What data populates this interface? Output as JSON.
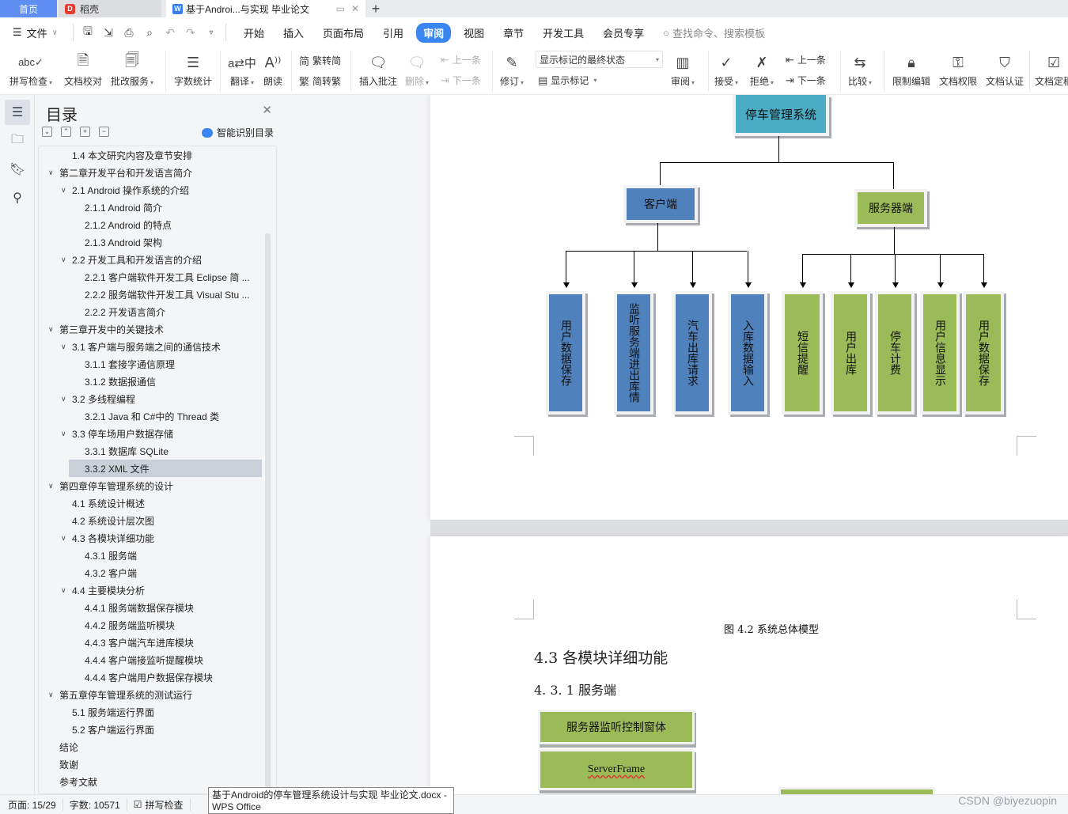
{
  "tabs": {
    "home": "首页",
    "daoke": "稻壳",
    "doc_title": "基于Androi...与实现 毕业论文",
    "new_tab": "+"
  },
  "menubar": {
    "file": "文件",
    "menus": [
      "开始",
      "插入",
      "页面布局",
      "引用",
      "审阅",
      "视图",
      "章节",
      "开发工具",
      "会员专享"
    ],
    "active_menu": "审阅",
    "search_placeholder": "查找命令、搜索模板"
  },
  "ribbon": {
    "spell_check": "拼写检查",
    "doc_proofread": "文档校对",
    "revise_service": "批改服务",
    "word_count": "字数统计",
    "translate": "翻译",
    "read_aloud": "朗读",
    "trad_to_simp": "繁转简",
    "simp_to_trad": "简转繁",
    "insert_comment": "插入批注",
    "delete": "删除",
    "prev_comment": "上一条",
    "next_comment": "下一条",
    "track_changes": "修订",
    "markup_state": "显示标记的最终状态",
    "show_markup": "显示标记",
    "review": "审阅",
    "accept": "接受",
    "reject": "拒绝",
    "prev_change": "上一条",
    "next_change": "下一条",
    "compare": "比较",
    "restrict_edit": "限制编辑",
    "doc_permission": "文档权限",
    "doc_cert": "文档认证",
    "doc_final": "文档定稿"
  },
  "toc": {
    "title": "目录",
    "smart_detect": "智能识别目录",
    "items": [
      {
        "label": "1.4  本文研究内容及章节安排",
        "level": 2,
        "expandable": false
      },
      {
        "label": "第二章开发平台和开发语言简介",
        "level": 1,
        "expandable": true
      },
      {
        "label": "2.1 Android 操作系统的介绍",
        "level": 2,
        "expandable": true
      },
      {
        "label": "2.1.1 Android 简介",
        "level": 3,
        "expandable": false
      },
      {
        "label": "2.1.2 Android 的特点",
        "level": 3,
        "expandable": false
      },
      {
        "label": "2.1.3 Android 架构",
        "level": 3,
        "expandable": false
      },
      {
        "label": "2.2 开发工具和开发语言的介绍",
        "level": 2,
        "expandable": true
      },
      {
        "label": "2.2.1    客户端软件开发工具 Eclipse 简 ...",
        "level": 3,
        "expandable": false
      },
      {
        "label": "2.2.2  服务端软件开发工具 Visual Stu ...",
        "level": 3,
        "expandable": false
      },
      {
        "label": "2.2.2  开发语言简介",
        "level": 3,
        "expandable": false
      },
      {
        "label": "第三章开发中的关键技术",
        "level": 1,
        "expandable": true
      },
      {
        "label": "3.1  客户端与服务端之间的通信技术",
        "level": 2,
        "expandable": true
      },
      {
        "label": "3.1.1  套接字通信原理",
        "level": 3,
        "expandable": false
      },
      {
        "label": "3.1.2  数据报通信",
        "level": 3,
        "expandable": false
      },
      {
        "label": "3.2 多线程编程",
        "level": 2,
        "expandable": true
      },
      {
        "label": "3.2.1    Java 和 C#中的 Thread 类",
        "level": 3,
        "expandable": false
      },
      {
        "label": "3.3  停车场用户数据存储",
        "level": 2,
        "expandable": true
      },
      {
        "label": "3.3.1  数据库 SQLite",
        "level": 3,
        "expandable": false
      },
      {
        "label": "3.3.2 XML 文件",
        "level": 3,
        "expandable": false,
        "selected": true
      },
      {
        "label": "第四章停车管理系统的设计",
        "level": 1,
        "expandable": true
      },
      {
        "label": "4.1  系统设计概述",
        "level": 2,
        "expandable": false
      },
      {
        "label": "4.2    系统设计层次图",
        "level": 2,
        "expandable": false
      },
      {
        "label": "4.3  各模块详细功能",
        "level": 2,
        "expandable": true
      },
      {
        "label": "4.3.1  服务端",
        "level": 3,
        "expandable": false
      },
      {
        "label": "4.3.2  客户端",
        "level": 3,
        "expandable": false
      },
      {
        "label": "4.4  主要模块分析",
        "level": 2,
        "expandable": true
      },
      {
        "label": "4.4.1  服务端数据保存模块",
        "level": 3,
        "expandable": false
      },
      {
        "label": "4.4.2  服务端监听模块",
        "level": 3,
        "expandable": false
      },
      {
        "label": "4.4.3  客户端汽车进库模块",
        "level": 3,
        "expandable": false
      },
      {
        "label": "4.4.4  客户端接监听提醒模块",
        "level": 3,
        "expandable": false
      },
      {
        "label": "4.4.4  客户端用户数据保存模块",
        "level": 3,
        "expandable": false
      },
      {
        "label": "第五章停车管理系统的测试运行",
        "level": 1,
        "expandable": true
      },
      {
        "label": "5.1  服务端运行界面",
        "level": 2,
        "expandable": false
      },
      {
        "label": "5.2  客户端运行界面",
        "level": 2,
        "expandable": false
      },
      {
        "label": "结论",
        "level": 0,
        "expandable": false
      },
      {
        "label": "致谢",
        "level": 0,
        "expandable": false
      },
      {
        "label": "参考文献",
        "level": 0,
        "expandable": false
      }
    ]
  },
  "diagram": {
    "root": "停车管理系统",
    "client": "客户端",
    "server": "服务器端",
    "client_children": [
      "用户数据保存",
      "监听服务端进出库情",
      "汽车出库请求",
      "入库数据输入"
    ],
    "server_children": [
      "短信提醒",
      "用户出库",
      "停车计费",
      "用户信息显示",
      "用户数据保存"
    ],
    "colors": {
      "root": "#4bacc6",
      "client": "#4f81bd",
      "server": "#9bbb59"
    }
  },
  "document": {
    "figure_caption": "图 4.2  系统总体模型",
    "heading_43": "4.3  各模块详细功能",
    "heading_431": "4. 3. 1  服务端",
    "box_server_listen": "服务器监听控制窗体",
    "box_serverframe": "ServerFrame"
  },
  "statusbar": {
    "page": "页面: 15/29",
    "words": "字数: 10571",
    "spell": "拼写检查"
  },
  "tooltip": "基于Android的停车管理系统设计与实现 毕业论文.docx - WPS Office",
  "watermark": "CSDN @biyezuopin"
}
